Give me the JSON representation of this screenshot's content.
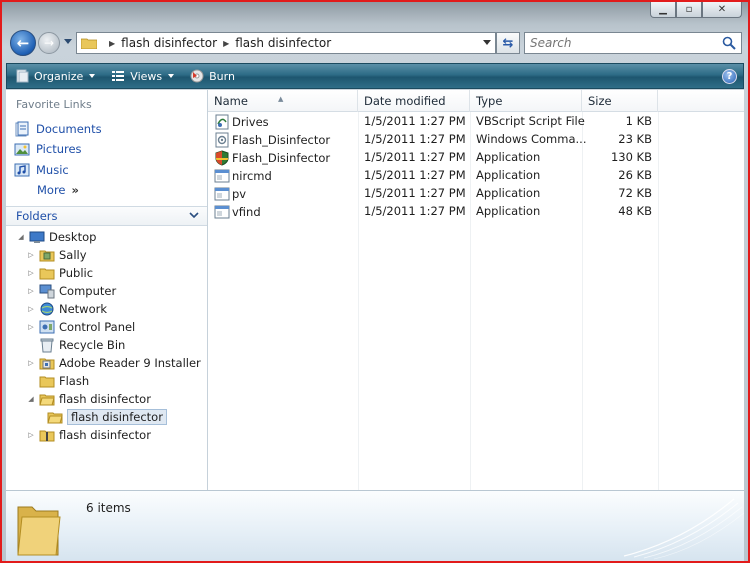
{
  "address": {
    "crumbs": [
      "flash disinfector",
      "flash disinfector"
    ],
    "search_placeholder": "Search"
  },
  "toolbar": {
    "organize": "Organize",
    "views": "Views",
    "burn": "Burn"
  },
  "favorites": {
    "header": "Favorite Links",
    "items": [
      {
        "label": "Documents",
        "icon": "documents-icon"
      },
      {
        "label": "Pictures",
        "icon": "pictures-icon"
      },
      {
        "label": "Music",
        "icon": "music-icon"
      }
    ],
    "more": "More"
  },
  "folders": {
    "header": "Folders",
    "tree": [
      {
        "label": "Desktop",
        "icon": "desktop-icon",
        "twisty": "expanded"
      },
      {
        "label": "Sally",
        "icon": "user-folder-icon",
        "twisty": "collapsed"
      },
      {
        "label": "Public",
        "icon": "folder-icon",
        "twisty": "collapsed"
      },
      {
        "label": "Computer",
        "icon": "computer-icon",
        "twisty": "collapsed"
      },
      {
        "label": "Network",
        "icon": "network-icon",
        "twisty": "collapsed"
      },
      {
        "label": "Control Panel",
        "icon": "control-panel-icon",
        "twisty": "collapsed"
      },
      {
        "label": "Recycle Bin",
        "icon": "recycle-bin-icon",
        "twisty": "none"
      },
      {
        "label": "Adobe Reader 9 Installer",
        "icon": "installer-folder-icon",
        "twisty": "collapsed"
      },
      {
        "label": "Flash",
        "icon": "folder-icon",
        "twisty": "none"
      },
      {
        "label": "flash disinfector",
        "icon": "folder-icon",
        "twisty": "expanded"
      },
      {
        "label": "flash disinfector",
        "icon": "folder-icon",
        "twisty": "none",
        "selected": true
      },
      {
        "label": "flash disinfector",
        "icon": "zip-folder-icon",
        "twisty": "collapsed"
      }
    ]
  },
  "columns": {
    "name": "Name",
    "date": "Date modified",
    "type": "Type",
    "size": "Size"
  },
  "files": [
    {
      "name": "Drives",
      "date": "1/5/2011 1:27 PM",
      "type": "VBScript Script File",
      "size": "1 KB",
      "icon": "vbscript-icon"
    },
    {
      "name": "Flash_Disinfector",
      "date": "1/5/2011 1:27 PM",
      "type": "Windows Comma...",
      "size": "23 KB",
      "icon": "cmd-script-icon"
    },
    {
      "name": "Flash_Disinfector",
      "date": "1/5/2011 1:27 PM",
      "type": "Application",
      "size": "130 KB",
      "icon": "shield-app-icon"
    },
    {
      "name": "nircmd",
      "date": "1/5/2011 1:27 PM",
      "type": "Application",
      "size": "26 KB",
      "icon": "app-icon"
    },
    {
      "name": "pv",
      "date": "1/5/2011 1:27 PM",
      "type": "Application",
      "size": "72 KB",
      "icon": "app-icon"
    },
    {
      "name": "vfind",
      "date": "1/5/2011 1:27 PM",
      "type": "Application",
      "size": "48 KB",
      "icon": "app-icon"
    }
  ],
  "details": {
    "count": "6 items"
  },
  "colors": {
    "accent": "#1f4fa8",
    "command_bar": "#2d6b86",
    "frame_border": "#e21b1b"
  }
}
